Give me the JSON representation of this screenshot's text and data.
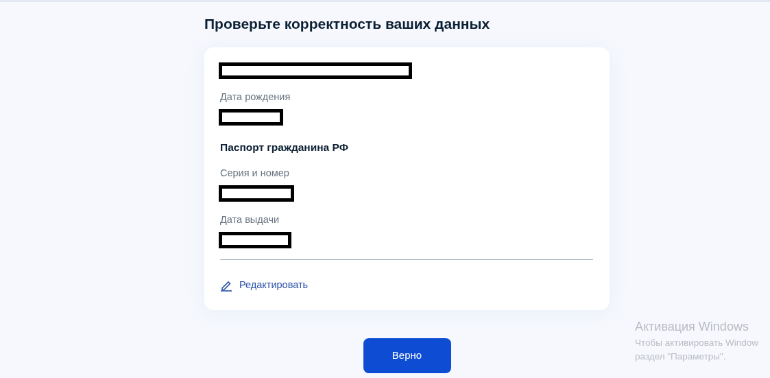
{
  "title": "Проверьте корректность ваших данных",
  "card": {
    "name_value": {
      "kind": "redacted"
    },
    "fields_top": [
      {
        "label": "Дата рождения",
        "value": {
          "kind": "redacted"
        }
      }
    ],
    "section_title": "Паспорт гражданина РФ",
    "fields": [
      {
        "label": "Серия и номер",
        "value": {
          "kind": "redacted"
        }
      },
      {
        "label": "Дата выдачи",
        "value": {
          "kind": "redacted"
        }
      }
    ],
    "edit_link": "Редактировать"
  },
  "confirm_button": "Верно",
  "os_notice": {
    "title": "Активация Windows",
    "lines": [
      "Чтобы активировать Window",
      "раздел \"Параметры\"."
    ]
  }
}
